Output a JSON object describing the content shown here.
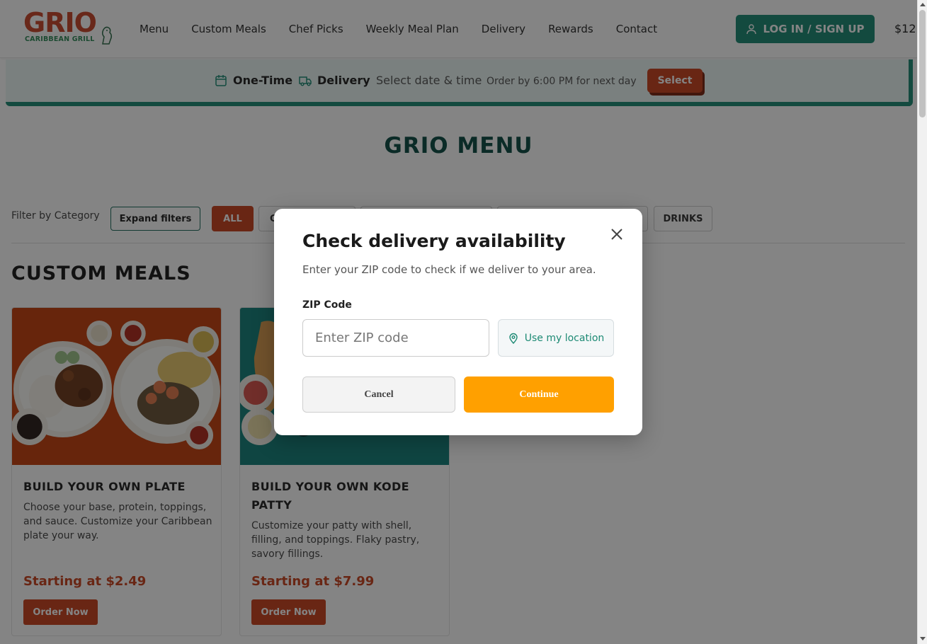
{
  "header": {
    "logo_text": "GRIO",
    "logo_subtext": "CARIBBEAN GRILL",
    "nav": [
      "Menu",
      "Custom Meals",
      "Chef Picks",
      "Weekly Meal Plan",
      "Delivery",
      "Rewards",
      "Contact"
    ],
    "login_label": "LOG IN / SIGN UP",
    "cart_amount": "$12."
  },
  "order_bar": {
    "order_type": "One-Time",
    "mode": "Delivery",
    "datetime_prompt": "Select date & time",
    "cutoff_note": "Order by 6:00 PM for next day",
    "select_label": "Select"
  },
  "page": {
    "title": "GRIO MENU",
    "filter_label": "Filter by Category",
    "expand_label": "Expand filters",
    "chips": [
      "ALL",
      "C",
      "",
      "",
      "DRINKS"
    ],
    "section_title": "CUSTOM MEALS"
  },
  "cards": [
    {
      "title": "BUILD YOUR OWN PLATE",
      "description": "Choose your base, protein, toppings, and sauce. Customize your Caribbean plate your way.",
      "price": "Starting at $2.49",
      "button": "Order Now"
    },
    {
      "title": "BUILD YOUR OWN KODE PATTY",
      "description": "Customize your patty with shell, filling, and toppings. Flaky pastry, savory fillings.",
      "price": "Starting at $7.99",
      "button": "Order Now"
    }
  ],
  "modal": {
    "title": "Check delivery availability",
    "subtitle": "Enter your ZIP code to check if we deliver to your area.",
    "zip_label": "ZIP Code",
    "zip_placeholder": "Enter ZIP code",
    "zip_value": "",
    "location_label": "Use my location",
    "cancel_label": "Cancel",
    "continue_label": "Continue"
  },
  "colors": {
    "brand_red": "#c8431f",
    "brand_green": "#1d8a74",
    "title_green": "#0d4d44",
    "continue_orange": "#ffa000"
  }
}
